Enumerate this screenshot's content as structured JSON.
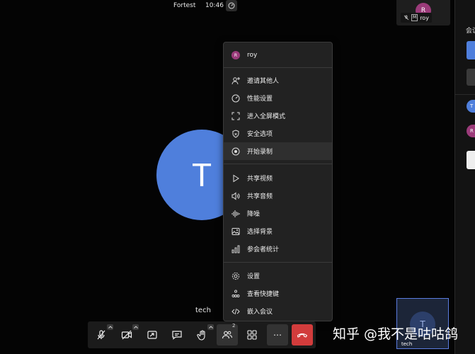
{
  "topbar": {
    "meeting_name": "Fortest",
    "time": "10:46"
  },
  "main_speaker": {
    "initial": "T",
    "name": "tech",
    "color": "#4f7fdc"
  },
  "self_tile": {
    "initial": "R",
    "name": "roy",
    "badge": "M"
  },
  "menu": {
    "user": {
      "initial": "R",
      "name": "roy"
    },
    "groups": [
      [
        "邀请其他人",
        "性能设置",
        "进入全屏模式",
        "安全选项",
        "开始录制"
      ],
      [
        "共享视频",
        "共享音频",
        "降噪",
        "选择背景",
        "参会者统计"
      ],
      [
        "设置",
        "查看快捷键",
        "嵌入会议"
      ]
    ],
    "active_item": "开始录制"
  },
  "toolbar": {
    "participants_count": "2",
    "more_label": "⋯"
  },
  "right_panel": {
    "title": "会议",
    "avatar_t": "T",
    "avatar_r": "R"
  },
  "pip": {
    "initial": "T",
    "name": "tech"
  },
  "watermark": "知乎 @我不是咕咕鸽",
  "colors": {
    "accent": "#4f7fdc",
    "end_call": "#d23c3c",
    "self_avatar": "#9b3b7a"
  }
}
